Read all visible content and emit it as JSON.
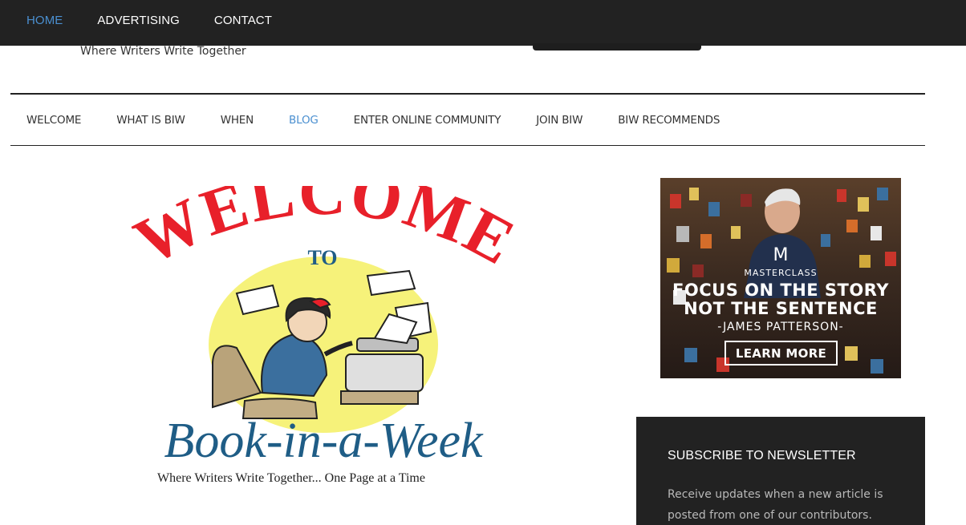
{
  "top_nav": {
    "items": [
      {
        "label": "HOME",
        "active": true
      },
      {
        "label": "ADVERTISING",
        "active": false
      },
      {
        "label": "CONTACT",
        "active": false
      }
    ]
  },
  "header": {
    "tagline": "Where Writers Write Together"
  },
  "main_nav": {
    "items": [
      {
        "label": "WELCOME",
        "active": false
      },
      {
        "label": "WHAT IS BIW",
        "active": false
      },
      {
        "label": "WHEN",
        "active": false
      },
      {
        "label": "BLOG",
        "active": true
      },
      {
        "label": "ENTER ONLINE COMMUNITY",
        "active": false
      },
      {
        "label": "JOIN BIW",
        "active": false
      },
      {
        "label": "BIW RECOMMENDS",
        "active": false
      }
    ]
  },
  "logo": {
    "arc_text": "WELCOME",
    "to_text": "TO",
    "name": "Book-in-a-Week",
    "caption": "Where Writers Write Together... One Page at a Time"
  },
  "ad": {
    "brand": "MASTERCLASS",
    "brand_letter": "M",
    "line1": "FOCUS ON THE STORY",
    "line2": "NOT THE SENTENCE",
    "author": "-JAMES PATTERSON-",
    "button": "LEARN MORE"
  },
  "newsletter": {
    "title": "SUBSCRIBE TO NEWSLETTER",
    "text": "Receive updates when a new article is posted from one of our contributors."
  },
  "colors": {
    "topbar": "#222222",
    "accent": "#4a8fd0",
    "logo_red": "#e8202a",
    "logo_blue": "#1f5d86"
  }
}
